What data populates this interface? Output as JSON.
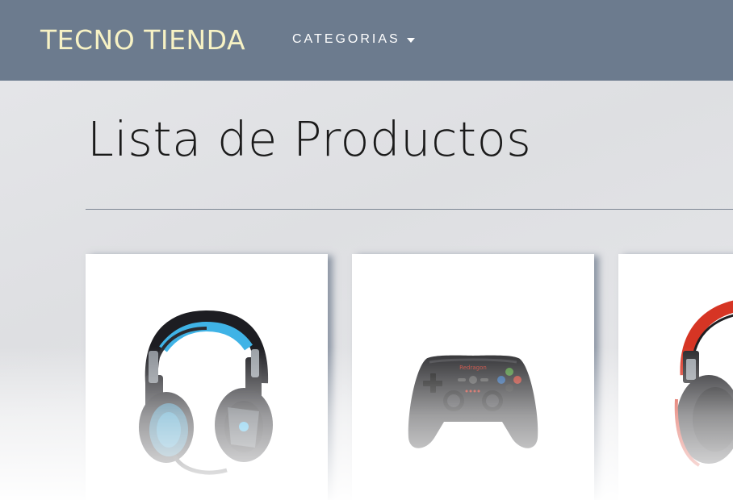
{
  "navbar": {
    "brand": "TECNO TIENDA",
    "categories_label": "CATEGORIAS"
  },
  "main": {
    "title": "Lista de Productos"
  },
  "products": [
    {
      "image_icon": "headset-blue-black-icon"
    },
    {
      "image_icon": "gamepad-black-icon"
    },
    {
      "image_icon": "headset-red-black-icon"
    }
  ],
  "colors": {
    "navbar_bg": "#6c7b8e",
    "brand_text": "#f7f2c4",
    "divider": "#7d8794"
  }
}
